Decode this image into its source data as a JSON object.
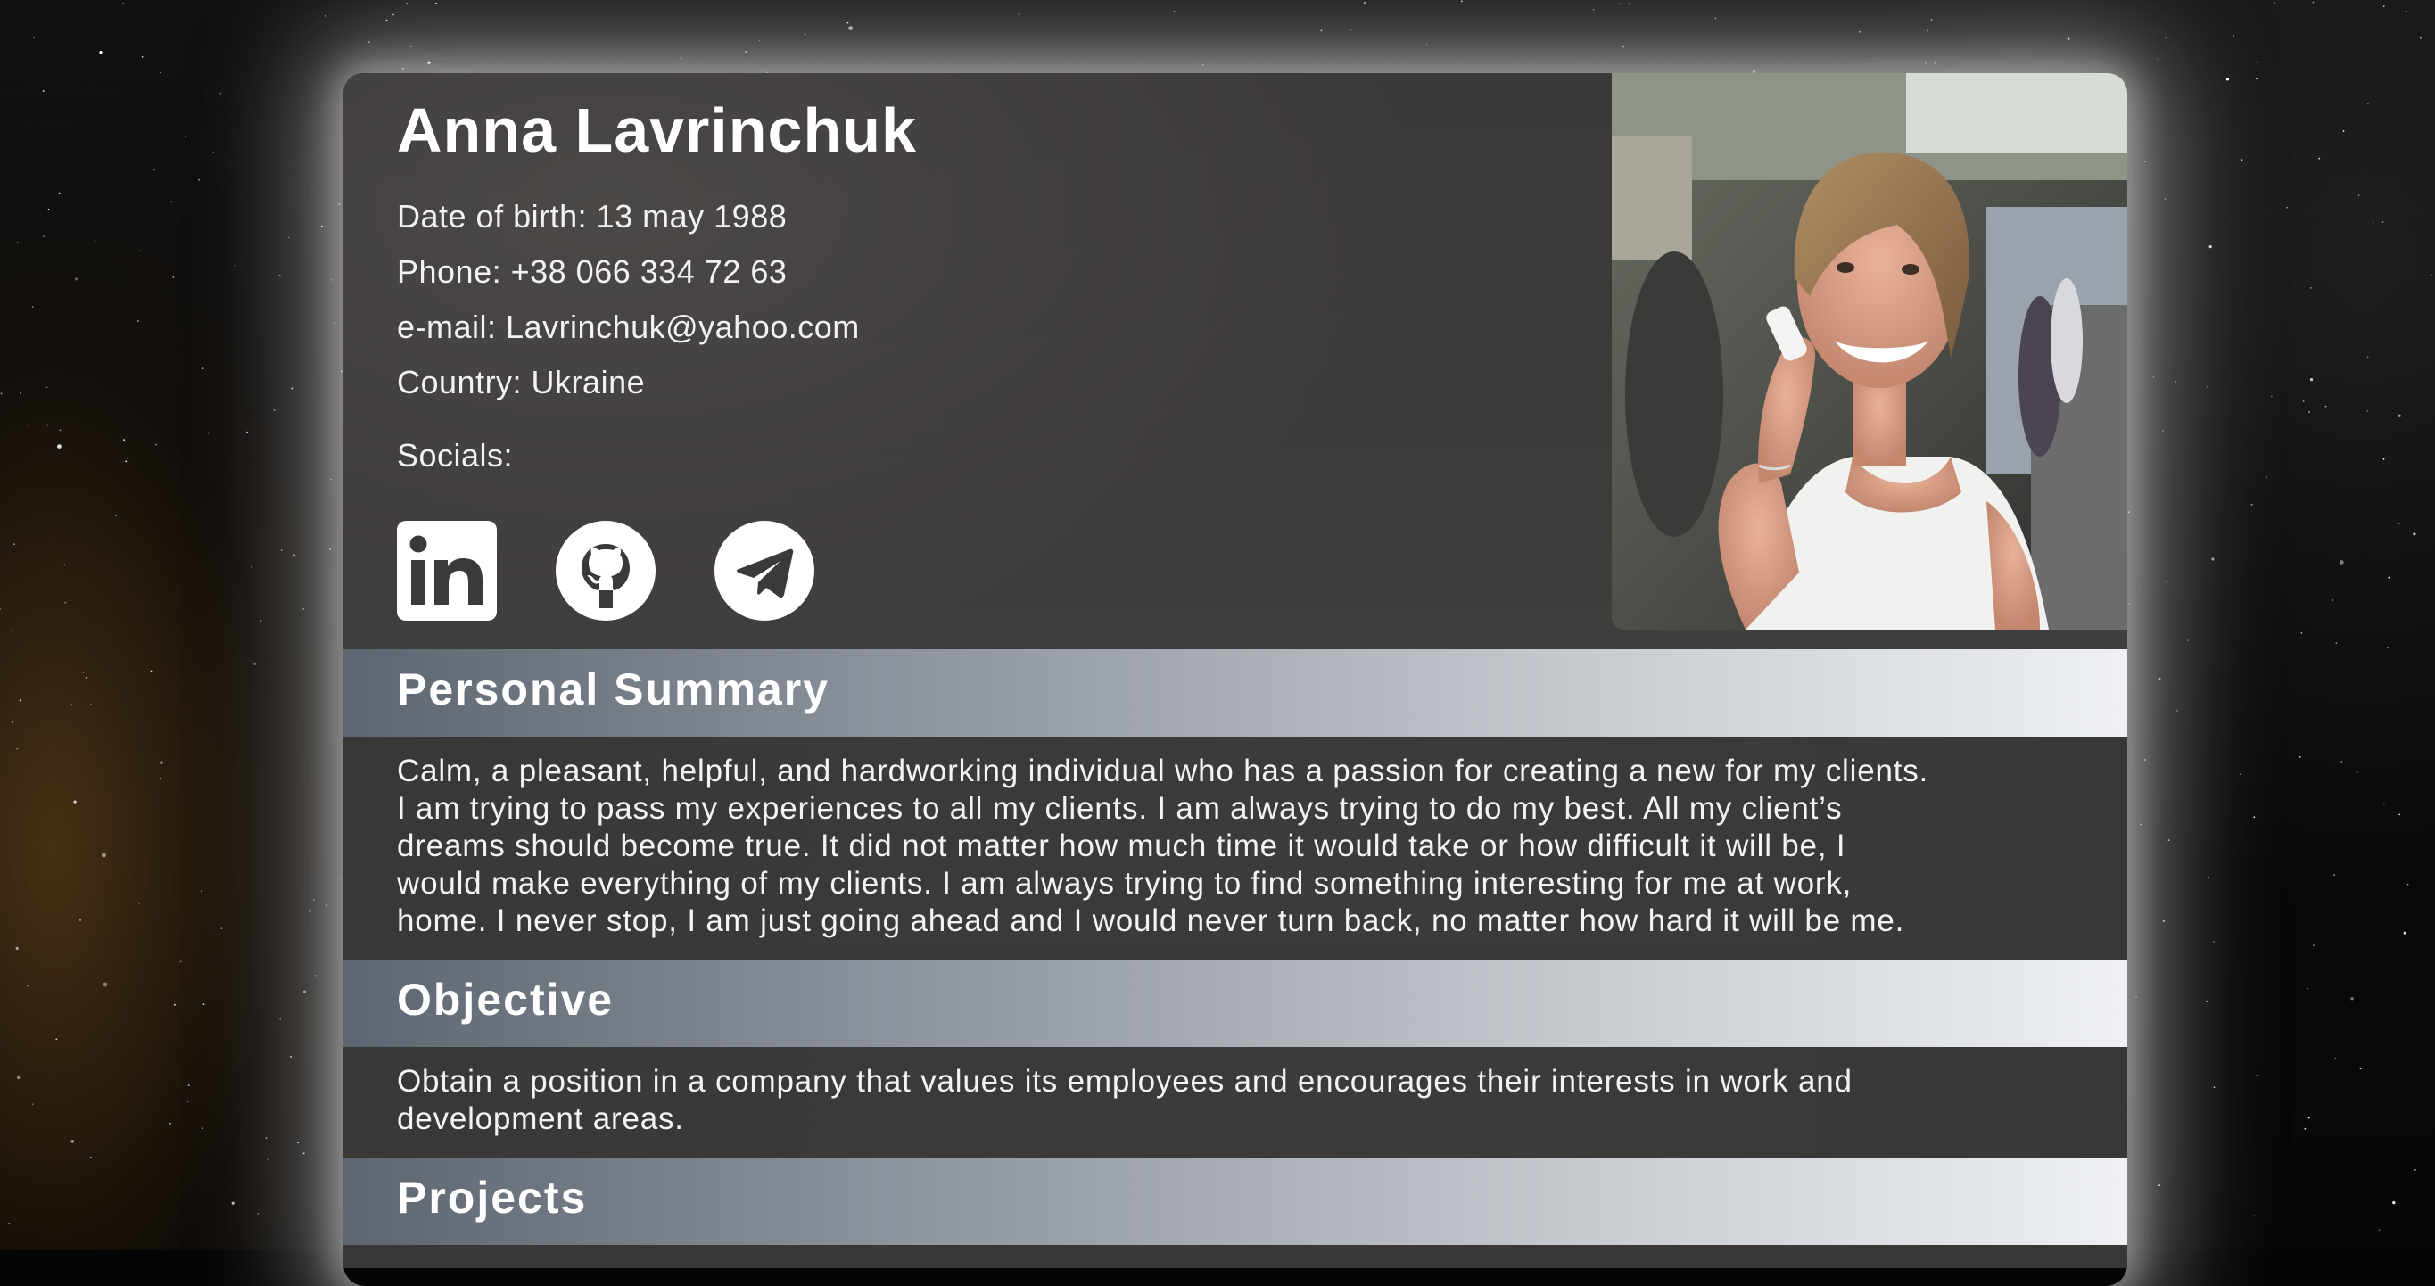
{
  "profile": {
    "name": "Anna Lavrinchuk",
    "dob": "Date of birth: 13 may 1988",
    "phone": "Phone: +38 066 334 72 63",
    "email": "e-mail: Lavrinchuk@yahoo.com",
    "country": "Country: Ukraine",
    "socials_label": "Socials:"
  },
  "socials": [
    {
      "icon": "linkedin-icon"
    },
    {
      "icon": "github-icon"
    },
    {
      "icon": "telegram-icon"
    }
  ],
  "photo": {
    "alt": "Portrait of a smiling woman holding a phone"
  },
  "sections": {
    "summary": {
      "title": "Personal Summary",
      "text": "Calm, a pleasant, helpful, and hardworking individual who has a passion for creating a new for my clients.\nI am trying to pass my experiences to all my clients. I am always trying to do my best. All my client’s\ndreams should become true. It did not matter how much time it would take or how difficult it will be, I\nwould make everything of my clients. I am always trying to find something interesting for me at work,\nhome. I never stop, I am just going ahead and I would never turn back, no matter how hard it will be me."
    },
    "objective": {
      "title": "Objective",
      "text": "Obtain a position in a company that values its employees and encourages their interests in work and\ndevelopment areas."
    },
    "projects": {
      "title": "Projects"
    }
  },
  "colors": {
    "card_bg": "#3a3837",
    "header_gradient_start": "#5d6570",
    "header_gradient_end": "#eef0f3",
    "text": "#ffffff"
  }
}
